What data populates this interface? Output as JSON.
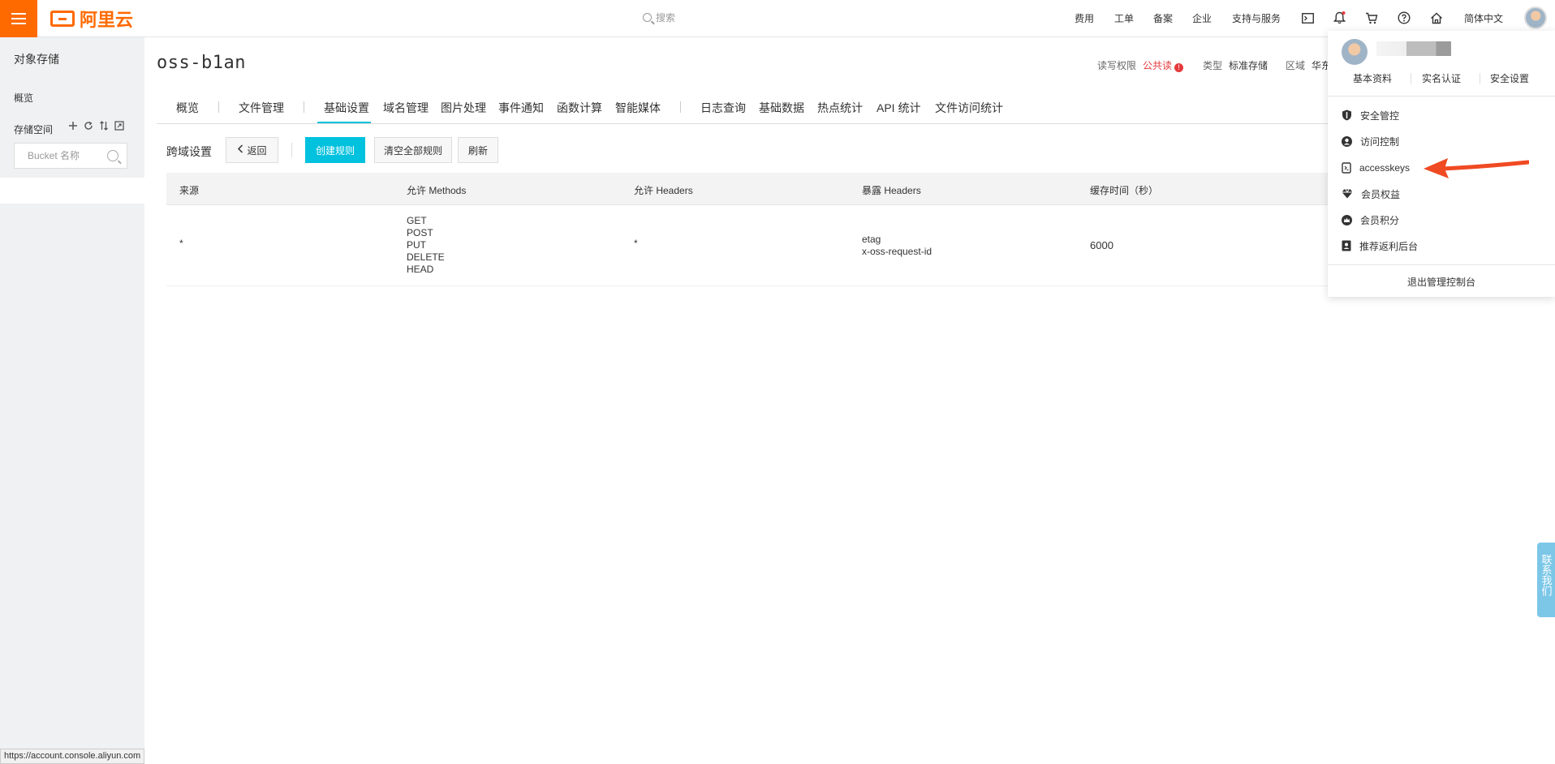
{
  "topbar": {
    "logo_text": "阿里云",
    "search_placeholder": "搜索",
    "nav": [
      "费用",
      "工单",
      "备案",
      "企业",
      "支持与服务"
    ],
    "language": "简体中文",
    "icons": [
      "terminal-icon",
      "bell-icon",
      "cart-icon",
      "help-icon",
      "home-icon"
    ]
  },
  "sidebar": {
    "title": "对象存储",
    "overview": "概览",
    "space_label": "存储空间",
    "search_placeholder": "Bucket 名称"
  },
  "bucket": {
    "name": "oss-b1an",
    "meta": {
      "permission_label": "读写权限",
      "permission_value": "公共读",
      "type_label": "类型",
      "type_value": "标准存储",
      "region_label": "区域",
      "region_value": "华东"
    }
  },
  "tabs": [
    "概览",
    "文件管理",
    "基础设置",
    "域名管理",
    "图片处理",
    "事件通知",
    "函数计算",
    "智能媒体",
    "日志查询",
    "基础数据",
    "热点统计",
    "API 统计",
    "文件访问统计"
  ],
  "toolbar": {
    "label": "跨域设置",
    "back": "返回",
    "create": "创建规则",
    "clear": "清空全部规则",
    "refresh": "刷新"
  },
  "table": {
    "headers": [
      "来源",
      "允许 Methods",
      "允许 Headers",
      "暴露 Headers",
      "缓存时间（秒）"
    ],
    "row": {
      "source": "*",
      "methods": [
        "GET",
        "POST",
        "PUT",
        "DELETE",
        "HEAD"
      ],
      "allow_headers": "*",
      "expose_headers": [
        "etag",
        "x-oss-request-id"
      ],
      "cache": "6000"
    }
  },
  "dropdown": {
    "links": [
      "基本资料",
      "实名认证",
      "安全设置"
    ],
    "items": [
      {
        "label": "安全管控",
        "icon": "shield-icon"
      },
      {
        "label": "访问控制",
        "icon": "user-icon"
      },
      {
        "label": "accesskeys",
        "icon": "key-icon"
      },
      {
        "label": "会员权益",
        "icon": "diamond-icon"
      },
      {
        "label": "会员积分",
        "icon": "crown-icon"
      },
      {
        "label": "推荐返利后台",
        "icon": "contact-card-icon"
      }
    ],
    "logout": "退出管理控制台"
  },
  "contact": "联系我们",
  "status_url": "https://account.console.aliyun.com",
  "colors": {
    "brand": "#ff6a00",
    "primary": "#00c1de",
    "warning": "#e4393c",
    "annotation_arrow": "#f04a23"
  }
}
